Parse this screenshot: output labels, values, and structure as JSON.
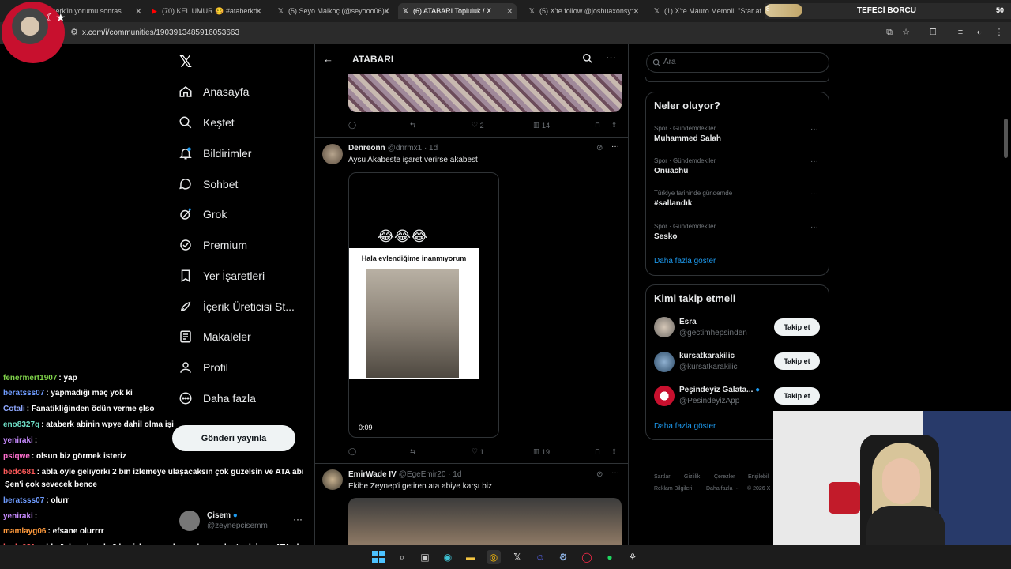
{
  "browser": {
    "tabs": [
      {
        "label": "taberk'in yorumu sonras",
        "icon": "x-icon",
        "active": false
      },
      {
        "label": "(70) KEL UMUR 🥴 #ataberkd",
        "icon": "youtube-icon",
        "active": false
      },
      {
        "label": "(5) Seyo Malkoç (@seyooo06) /",
        "icon": "x-icon",
        "active": false
      },
      {
        "label": "(6) ATABARI Topluluk / X",
        "icon": "x-icon",
        "active": true
      },
      {
        "label": "(5) X'te follow @joshuaxonsy:",
        "icon": "x-icon",
        "active": false
      },
      {
        "label": "(1) X'te Mauro Memoli: \"Star af",
        "icon": "x-icon",
        "active": false
      }
    ],
    "url": "x.com/i/communities/1903913485916053663",
    "banner_title": "TEFECİ BORCU",
    "banner_number": "50",
    "banner_tag": "8"
  },
  "nav": {
    "logo": "𝕏",
    "items": [
      {
        "label": "Anasayfa",
        "icon": "home-icon"
      },
      {
        "label": "Keşfet",
        "icon": "search-icon"
      },
      {
        "label": "Bildirimler",
        "icon": "bell-icon"
      },
      {
        "label": "Sohbet",
        "icon": "chat-icon"
      },
      {
        "label": "Grok",
        "icon": "grok-icon"
      },
      {
        "label": "Premium",
        "icon": "premium-icon"
      },
      {
        "label": "Yer İşaretleri",
        "icon": "bookmark-icon"
      },
      {
        "label": "İçerik Üreticisi St...",
        "icon": "rocket-icon"
      },
      {
        "label": "Makaleler",
        "icon": "article-icon"
      },
      {
        "label": "Profil",
        "icon": "person-icon"
      },
      {
        "label": "Daha fazla",
        "icon": "more-circle-icon"
      }
    ],
    "post_button": "Gönderi yayınla",
    "account": {
      "name": "Çisem",
      "handle": "@zeynepcisemm"
    }
  },
  "chat": [
    {
      "user": "fenermert1907",
      "user_color": "#7fd24a",
      "msg": ": yap"
    },
    {
      "user": "beratsss07",
      "user_color": "#6f9cff",
      "msg": ": yapmadığı maç yok ki"
    },
    {
      "user": "Cotali",
      "user_color": "#8fa8ff",
      "msg": ": Fanatikliğinden ödün verme çlso"
    },
    {
      "user": "eno8327q",
      "user_color": "#6fe0c8",
      "msg": ": ataberk abinin wpye dahil olma işi"
    },
    {
      "user": "yeniraki",
      "user_color": "#c78bff",
      "msg": ":"
    },
    {
      "user": "psiqwe",
      "user_color": "#ff6fcf",
      "msg": ": olsun biz görmek isteriz"
    },
    {
      "user": "bedo681",
      "user_color": "#ff5a5a",
      "msg": ": abla öyle gelıyorkı 2 bın izlemeye ulaşacaksın çok güzelsin ve ATA abı"
    },
    {
      "user": "",
      "user_color": "#ffffff",
      "msg": "Şen'i çok sevecek bence"
    },
    {
      "user": "beratsss07",
      "user_color": "#6f9cff",
      "msg": ": olurr"
    },
    {
      "user": "yeniraki",
      "user_color": "#c78bff",
      "msg": ":"
    },
    {
      "user": "mamlayg06",
      "user_color": "#ff9a3c",
      "msg": ": efsane olurrrr"
    },
    {
      "user": "bedo681",
      "user_color": "#ff5a5a",
      "msg": ": abla öyle gelıyorkı 2 bın izlemeye ulaşacaksın çok güzelsin ve ATA abı"
    },
    {
      "user": "",
      "user_color": "#ffffff",
      "msg": "Şen'i çok sevecek bence"
    }
  ],
  "main": {
    "title": "ATABARI",
    "tweet0": {
      "likes": "2",
      "views": "14"
    },
    "tweet1": {
      "name": "Denreonn",
      "meta": "@dnrmx1 · 1d",
      "text": "Aysu Akabeste işaret verirse akabest",
      "emoji": "😂😂😂",
      "video_caption": "Hala evlendiğime inanmıyorum",
      "duration": "0:09",
      "likes": "1",
      "views": "19"
    },
    "tweet2": {
      "name": "EmirWade IV",
      "meta": "@EgeEmir20 · 1d",
      "text": "Ekibe Zeynep'i getiren ata abiye karşı biz"
    }
  },
  "sidebar": {
    "search_placeholder": "Ara",
    "trends_title": "Neler oluyor?",
    "trends": [
      {
        "category": "Spor · Gündemdekiler",
        "name": "Muhammed Salah"
      },
      {
        "category": "Spor · Gündemdekiler",
        "name": "Onuachu"
      },
      {
        "category": "Türkiye tarihinde gündemde",
        "name": "#sallandık"
      },
      {
        "category": "Spor · Gündemdekiler",
        "name": "Sesko"
      }
    ],
    "trends_more": "Daha fazla göster",
    "follow_title": "Kimi takip etmeli",
    "follow": [
      {
        "name": "Esra",
        "handle": "@gectimhepsinden",
        "button": "Takip et"
      },
      {
        "name": "kursatkarakilic",
        "handle": "@kursatkarakilic",
        "button": "Takip et"
      },
      {
        "name": "Peşindeyiz Galata...",
        "handle": "@PesindeyizApp",
        "button": "Takip et"
      }
    ],
    "follow_more": "Daha fazla göster",
    "footer": [
      "Şartlar",
      "Gizlilik",
      "Çerezler",
      "Erişilebil",
      "Reklam Bilgileri",
      "Daha fazla ···",
      "© 2026 X"
    ]
  },
  "colors": {
    "accent": "#1d9bf0",
    "background": "#000000",
    "border": "#2f3336",
    "muted": "#71767b",
    "verified": "#1d9bf0"
  }
}
